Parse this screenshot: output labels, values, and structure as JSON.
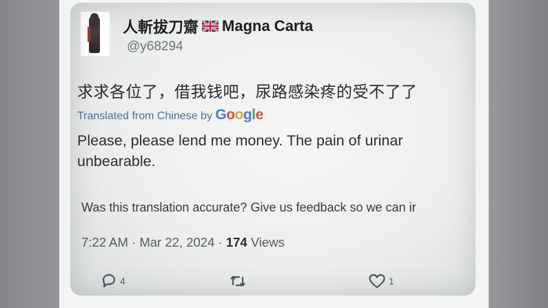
{
  "tweet": {
    "display_name": "人斬拔刀齋",
    "display_name_suffix": "Magna Carta",
    "flag_icon": "uk-flag-icon",
    "handle": "@y68294",
    "original_text": "求求各位了，借我钱吧，尿路感染疼的受不了了",
    "translated_label": "Translated from Chinese by",
    "translator_brand": "Google",
    "translation_line1": "Please, please lend me money. The pain of urinar",
    "translation_line2": "unbearable.",
    "feedback_text": "Was this translation accurate? Give us feedback so we can ir",
    "time": "7:22 AM",
    "date": "Mar 22, 2024",
    "views_count": "174",
    "views_label": "Views",
    "replies_count": "4",
    "likes_count": "1"
  },
  "colors": {
    "translated_link": "#4e6e96",
    "google_blue": "#4a7bd4",
    "google_red": "#d2533f",
    "google_yellow": "#d9a93a",
    "google_green": "#4f9a5b"
  }
}
